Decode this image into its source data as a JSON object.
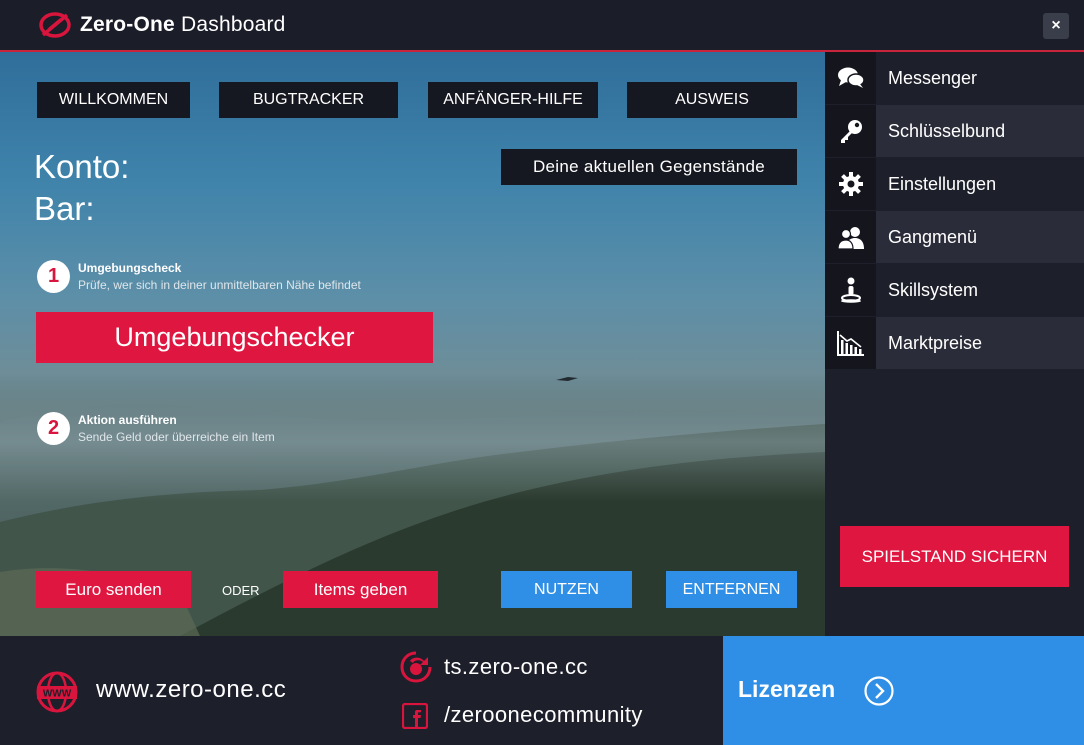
{
  "app": {
    "title_bold": "Zero-One",
    "title_rest": "Dashboard",
    "close_label": "×"
  },
  "nav": [
    "WILLKOMMEN",
    "BUGTRACKER",
    "ANFÄNGER-HILFE",
    "AUSWEIS"
  ],
  "account": {
    "konto_label": "Konto:",
    "bar_label": "Bar:"
  },
  "items_header": "Deine aktuellen Gegenstände",
  "step1": {
    "number": "1",
    "title": "Umgebungscheck",
    "subtitle": "Prüfe, wer sich in deiner unmittelbaren Nähe befindet",
    "button": "Umgebungschecker"
  },
  "step2": {
    "number": "2",
    "title": "Aktion ausführen",
    "subtitle": "Sende Geld oder überreiche ein Item"
  },
  "actions": {
    "euro": "Euro senden",
    "oder": "ODER",
    "items": "Items geben",
    "nutzen": "NUTZEN",
    "entfernen": "ENTFERNEN"
  },
  "sidebar": [
    {
      "label": "Messenger",
      "icon": "chat-icon"
    },
    {
      "label": "Schlüsselbund",
      "icon": "key-icon"
    },
    {
      "label": "Einstellungen",
      "icon": "gear-icon"
    },
    {
      "label": "Gangmenü",
      "icon": "people-icon"
    },
    {
      "label": "Skillsystem",
      "icon": "person-podium-icon"
    },
    {
      "label": "Marktpreise",
      "icon": "chart-down-icon"
    }
  ],
  "save_button": "SPIELSTAND SICHERN",
  "footer": {
    "website": "www.zero-one.cc",
    "teamspeak": "ts.zero-one.cc",
    "facebook": "/zeroonecommunity",
    "licenses": "Lizenzen"
  },
  "colors": {
    "accent_red": "#df163f",
    "accent_blue": "#2f8fe6",
    "dark": "#1d1f2b"
  }
}
